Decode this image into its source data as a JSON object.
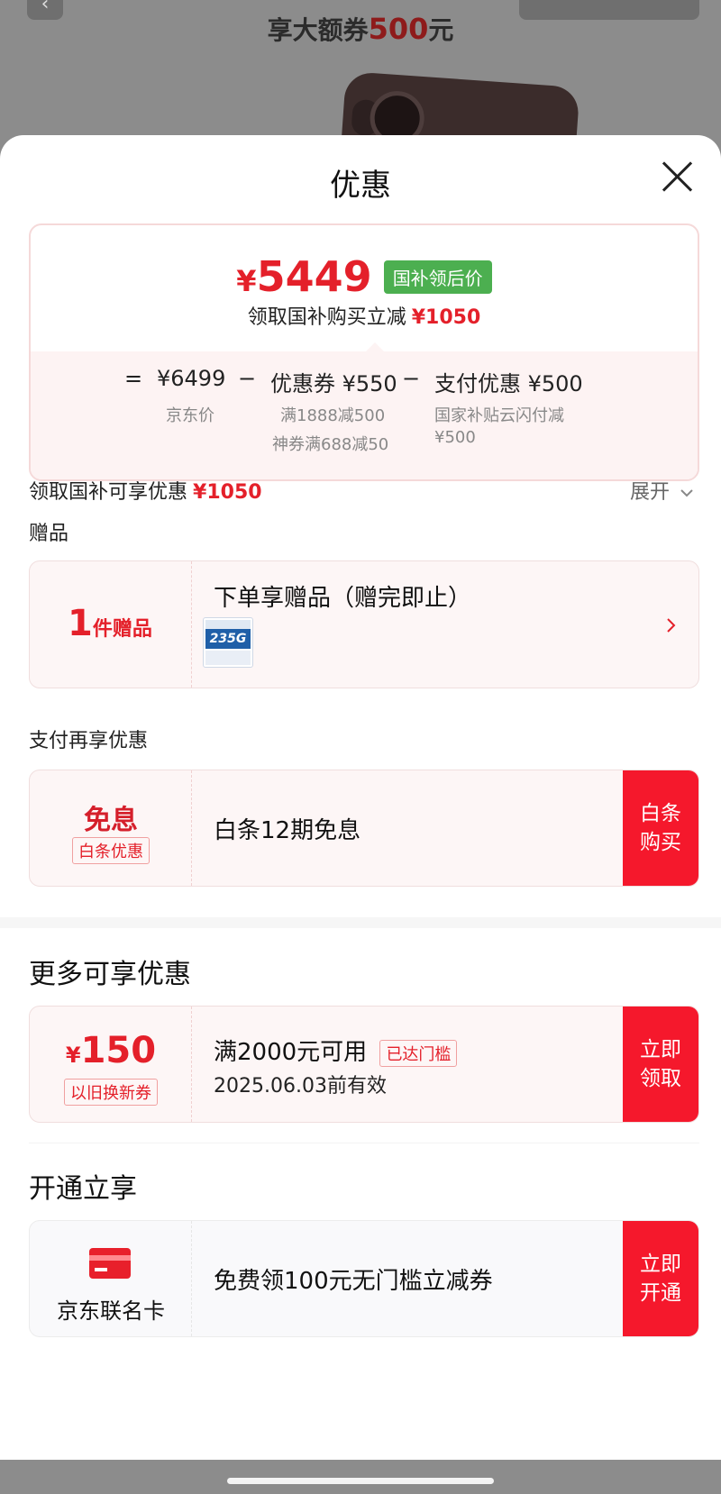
{
  "background": {
    "banner_prefix": "享大额券",
    "banner_highlight": "500",
    "banner_suffix": "元"
  },
  "sheet": {
    "title": "优惠"
  },
  "summary": {
    "final_price_symbol": "¥",
    "final_price": "5449",
    "price_tag": "国补领后价",
    "subsidy_text": "领取国补购买立减",
    "subsidy_amount": "¥1050",
    "eq": "=",
    "jd_price": "¥6499",
    "jd_price_label": "京东价",
    "minus1": "−",
    "coupon": "优惠券 ¥550",
    "coupon_detail_1": "满1888减500",
    "coupon_detail_2": "神券满688减50",
    "minus2": "−",
    "pay_discount": "支付优惠 ¥500",
    "pay_detail_1": "国家补贴云闪付减",
    "pay_detail_2": "¥500"
  },
  "subsidy_row": {
    "label": "领取国补可享优惠",
    "amount": "¥1050",
    "expand_label": "展开"
  },
  "gift": {
    "section_label": "赠品",
    "count": "1",
    "count_unit": "件赠品",
    "title": "下单享赠品（赠完即止）",
    "thumb_text": "235G"
  },
  "pay_section": {
    "label": "支付再享优惠",
    "left_title": "免息",
    "left_tag": "白条优惠",
    "text": "白条12期免息",
    "cta": "白条\n购买"
  },
  "more_section": {
    "title": "更多可享优惠",
    "coupon_symbol": "¥",
    "coupon_value": "150",
    "coupon_tag": "以旧换新券",
    "condition": "满2000元可用",
    "condition_tag": "已达门槛",
    "validity": "2025.06.03前有效",
    "cta": "立即\n领取"
  },
  "open_section": {
    "title": "开通立享",
    "card_label": "京东联名卡",
    "text": "免费领100元无门槛立减券",
    "cta": "立即\n开通"
  },
  "colors": {
    "accent_red": "#e4202a",
    "cta_red": "#f5182c",
    "tag_green": "#4caf50"
  }
}
